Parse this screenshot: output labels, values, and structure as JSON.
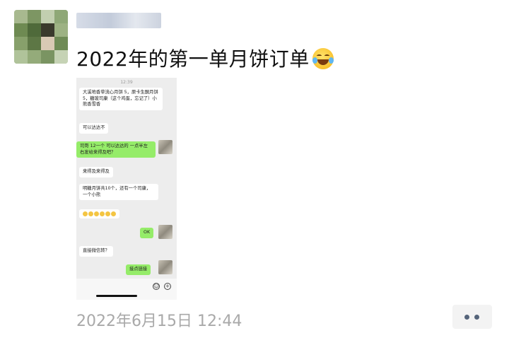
{
  "post": {
    "text": "2022年的第一单月饼订单",
    "emoji": "tears-of-joy-emoji",
    "timestamp": "2022年6月15日 12:44"
  },
  "screenshot": {
    "status_time": "12:39",
    "messages": [
      {
        "side": "left",
        "text": "大溪地香草流心月饼 5，原卡生酮月饼 5，糖玻司康（这个鸡蛋，忘记了）小熊香雪香"
      },
      {
        "side": "left",
        "text": "可以达达不"
      },
      {
        "side": "right",
        "text": "司哥 12一个 可以达达的 一点半左右发给来得及吧？"
      },
      {
        "side": "left",
        "text": "来得及来得及"
      },
      {
        "side": "left",
        "text": "明糖月饼共10个，还有一个司康，一个小熊"
      },
      {
        "side": "left",
        "text": "emoji-row"
      },
      {
        "side": "right",
        "text": "OK"
      },
      {
        "side": "left",
        "text": "直接微信转？"
      },
      {
        "side": "right",
        "text": "接点链接"
      }
    ]
  },
  "more_button_icon": "more-dots-icon"
}
